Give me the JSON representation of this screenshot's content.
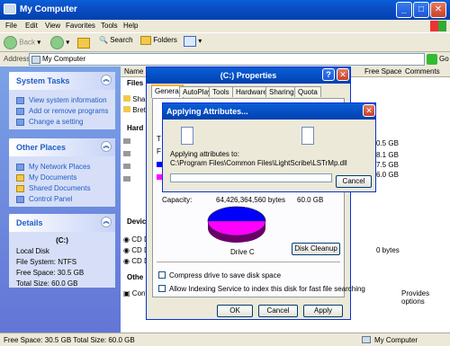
{
  "window": {
    "title": "My Computer"
  },
  "menu": [
    "File",
    "Edit",
    "View",
    "Favorites",
    "Tools",
    "Help"
  ],
  "toolbar": {
    "back": "Back",
    "search": "Search",
    "folders": "Folders"
  },
  "address": {
    "label": "Address",
    "value": "My Computer",
    "go": "Go"
  },
  "system_tasks": {
    "title": "System Tasks",
    "items": [
      "View system information",
      "Add or remove programs",
      "Change a setting"
    ]
  },
  "other_places": {
    "title": "Other Places",
    "items": [
      "My Network Places",
      "My Documents",
      "Shared Documents",
      "Control Panel"
    ]
  },
  "details": {
    "title": "Details",
    "name": "(C:)",
    "type": "Local Disk",
    "fs": "File System: NTFS",
    "free": "Free Space: 30.5 GB",
    "total": "Total Size: 60.0 GB"
  },
  "columns": {
    "name": "Name",
    "free": "Free Space",
    "comments": "Comments"
  },
  "groups": {
    "files": "Files",
    "hard": "Hard",
    "devices": "Devic",
    "other": "Othe"
  },
  "files_rows": [
    "Shar",
    "Bret"
  ],
  "free_values": [
    "0.5 GB",
    "8.1 GB",
    "7.5 GB",
    "6.0 GB"
  ],
  "device_rows": [
    "CD D",
    "CD D",
    "CD D"
  ],
  "device_free": "0 bytes",
  "other_row": "Contr",
  "other_comment": "Provides options",
  "status": {
    "left": "Free Space: 30.5 GB Total Size: 60.0 GB",
    "right": "My Computer"
  },
  "props": {
    "title": "(C:) Properties",
    "help": "?",
    "tabs": [
      "General",
      "AutoPlay",
      "Tools",
      "Hardware",
      "Sharing",
      "Quota"
    ],
    "t_label": "T",
    "f_label": "F",
    "capacity_label": "Capacity:",
    "capacity_bytes": "64,426,364,560 bytes",
    "capacity_gb": "60.0 GB",
    "drive": "Drive C",
    "cleanup": "Disk Cleanup",
    "compress": "Compress drive to save disk space",
    "index": "Allow Indexing Service to index this disk for fast file searching",
    "ok": "OK",
    "cancel": "Cancel",
    "apply": "Apply",
    "used_color": "#0000ff",
    "free_color": "#ff00ff"
  },
  "applying": {
    "title": "Applying Attributes...",
    "label": "Applying attributes to:",
    "path": "C:\\Program Files\\Common Files\\LightScribe\\LSTrMp.dll",
    "cancel": "Cancel",
    "progress": 0.0
  }
}
